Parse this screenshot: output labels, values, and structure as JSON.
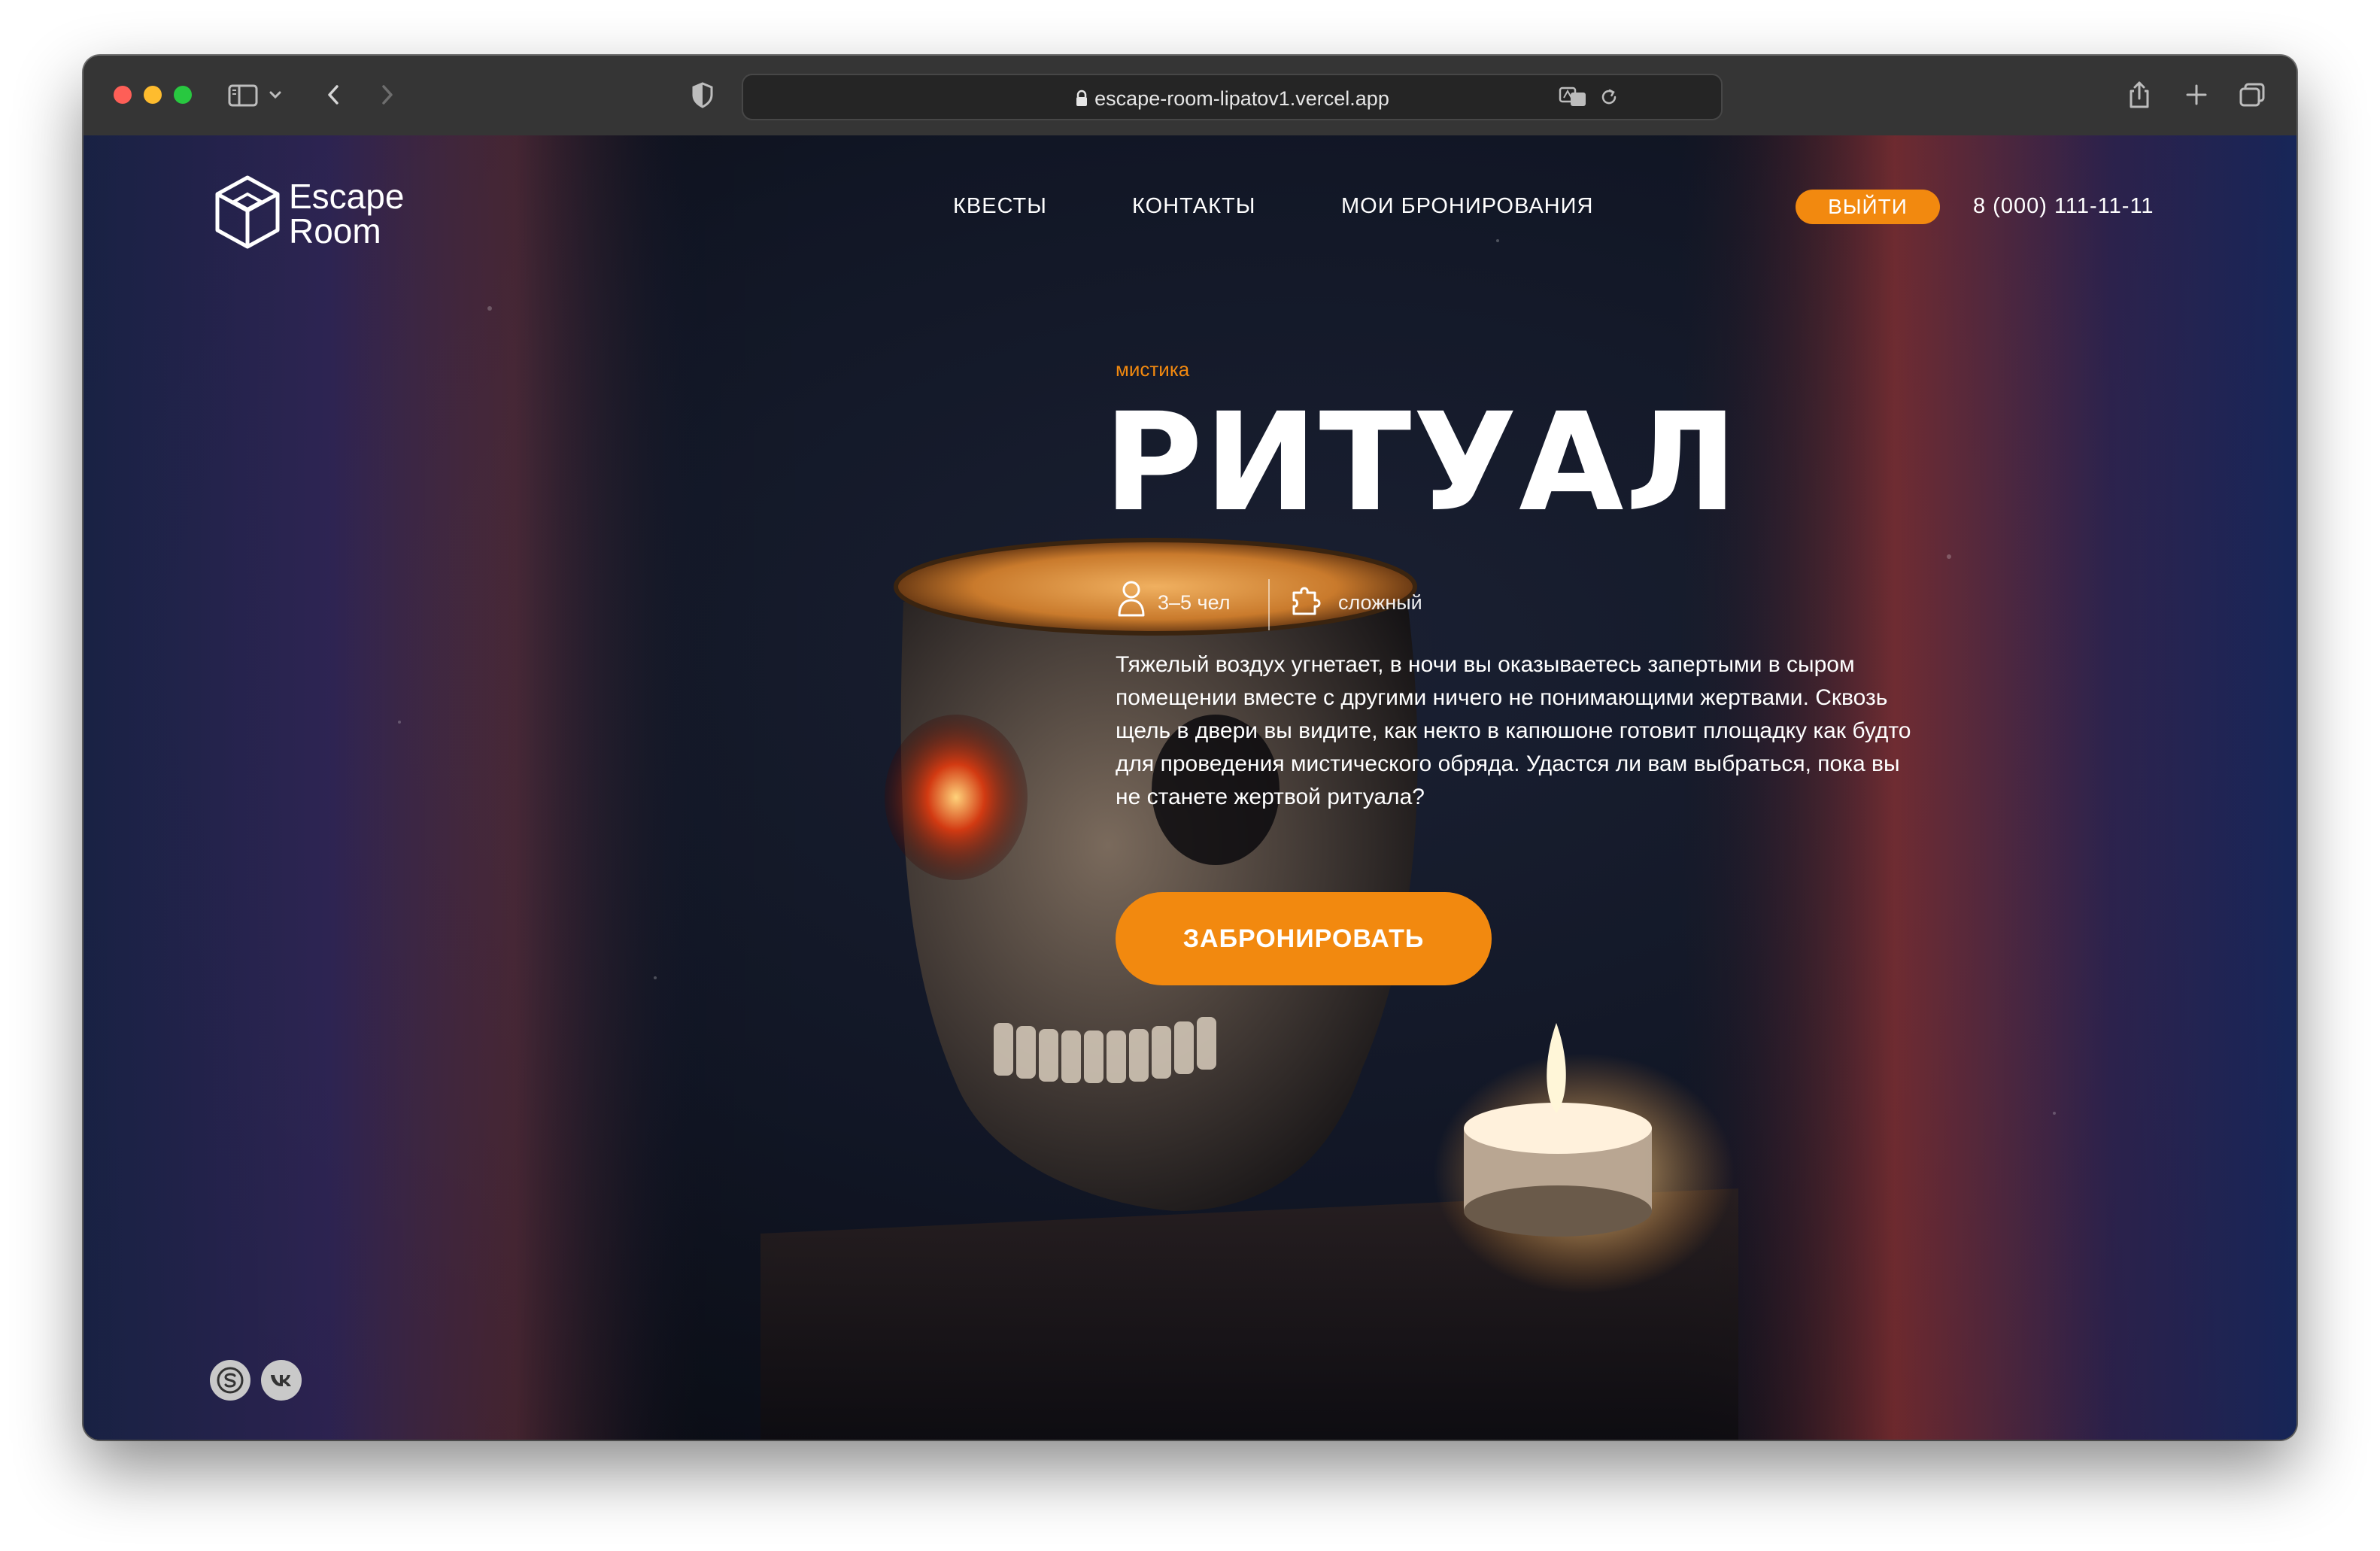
{
  "browser": {
    "url": "escape-room-lipatov1.vercel.app",
    "icons": [
      "sidebar-icon",
      "chevron-down-icon",
      "back-icon",
      "forward-icon",
      "privacy-shield-icon",
      "lock-icon",
      "translate-icon",
      "reload-icon",
      "share-icon",
      "new-tab-icon",
      "tabs-overview-icon"
    ]
  },
  "header": {
    "logo_line1": "Escape",
    "logo_line2": "Room",
    "nav": [
      "КВЕСТЫ",
      "КОНТАКТЫ",
      "МОИ БРОНИРОВАНИЯ"
    ],
    "logout_label": "ВЫЙТИ",
    "phone": "8 (000) 111-11-11"
  },
  "quest": {
    "genre": "мистика",
    "title": "РИТУАЛ",
    "players": "3–5 чел",
    "difficulty": "сложный",
    "description": "Тяжелый воздух угнетает, в ночи вы оказываетесь запертыми в сыром помещении вместе с другими ничего не понимающими жертвами. Сквозь щель в двери вы видите, как некто в капюшоне готовит площадку как будто для проведения мистического обряда. Удастся ли вам выбраться, пока вы не станете жертвой ритуала?",
    "book_label": "ЗАБРОНИРОВАТЬ"
  },
  "footer": {
    "social": [
      "skype-icon",
      "vk-icon"
    ]
  },
  "colors": {
    "accent": "#f2890f",
    "toolbar": "#353535",
    "text": "#ffffff"
  }
}
